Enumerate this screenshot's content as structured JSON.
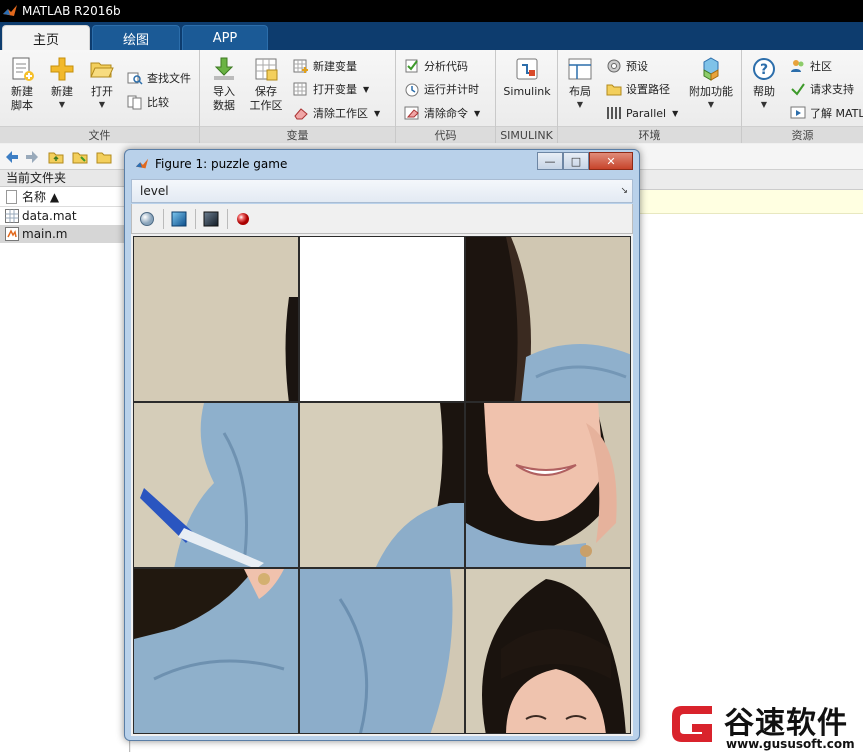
{
  "window": {
    "title": "MATLAB R2016b"
  },
  "tabs": [
    {
      "label": "主页",
      "active": true
    },
    {
      "label": "绘图",
      "active": false
    },
    {
      "label": "APP",
      "active": false
    }
  ],
  "ribbon": {
    "file_group": {
      "label": "文件",
      "new_script": "新建\n脚本",
      "new": "新建",
      "open": "打开",
      "find_files": "查找文件",
      "compare": "比较"
    },
    "variable_group": {
      "label": "变量",
      "import_data": "导入\n数据",
      "save_workspace": "保存\n工作区",
      "new_variable": "新建变量",
      "open_variable": "打开变量",
      "clear_workspace": "清除工作区"
    },
    "code_group": {
      "label": "代码",
      "analyze_code": "分析代码",
      "run_and_time": "运行并计时",
      "clear_commands": "清除命令"
    },
    "simulink_group": {
      "label": "SIMULINK",
      "simulink": "Simulink"
    },
    "environment_group": {
      "label": "环境",
      "layout": "布局",
      "preferences": "预设",
      "set_path": "设置路径",
      "parallel": "Parallel",
      "add_ons": "附加功能"
    },
    "resources_group": {
      "label": "资源",
      "help": "帮助",
      "community": "社区",
      "request_support": "请求支持",
      "learn_matlab": "了解 MATL"
    }
  },
  "current_folder": {
    "title": "当前文件夹",
    "column_name": "名称 ▲",
    "files": [
      {
        "name": "data.mat",
        "selected": false
      },
      {
        "name": "main.m",
        "selected": true
      }
    ]
  },
  "figure": {
    "title": "Figure 1: puzzle game",
    "menu_level": "level",
    "empty_tile_index": 1,
    "tiles": [
      "tile-0",
      "tile-1-empty",
      "tile-2",
      "tile-3",
      "tile-4",
      "tile-5",
      "tile-6",
      "tile-7",
      "tile-8"
    ]
  },
  "watermark": {
    "brand": "谷速软件",
    "url": "www.gususoft.com"
  },
  "colors": {
    "tabbar": "#0d3c6e",
    "figure_frame": "#b9d1ea",
    "close_button": "#c7442b",
    "watermark_red": "#d9232c"
  }
}
